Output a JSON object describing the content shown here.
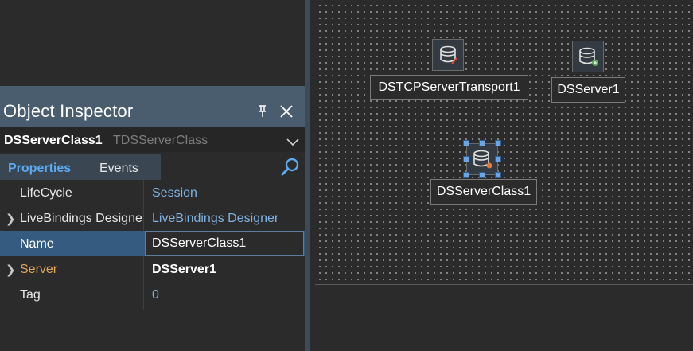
{
  "inspector": {
    "title": "Object Inspector",
    "selected_object": {
      "name": "DSServerClass1",
      "type": "TDSServerClass"
    },
    "tabs": [
      {
        "label": "Properties",
        "active": true
      },
      {
        "label": "Events",
        "active": false
      }
    ],
    "search": {
      "value": ""
    },
    "properties": [
      {
        "name": "LifeCycle",
        "value": "Session",
        "expandable": false
      },
      {
        "name": "LiveBindings Designer",
        "value": "LiveBindings Designer",
        "expandable": true
      },
      {
        "name": "Name",
        "value": "DSServerClass1",
        "expandable": false,
        "selected": true
      },
      {
        "name": "Server",
        "value": "DSServer1",
        "expandable": true
      },
      {
        "name": "Tag",
        "value": "0",
        "expandable": false
      }
    ]
  },
  "designer": {
    "components": [
      {
        "label": "DSTCPServerTransport1",
        "icon": "database-transport-icon"
      },
      {
        "label": "DSServer1",
        "icon": "database-server-icon"
      },
      {
        "label": "DSServerClass1",
        "icon": "database-class-icon",
        "selected": true
      }
    ]
  },
  "colors": {
    "accent": "#5da9f0",
    "title_bar": "#4a5d6e",
    "selected_row": "#365b80",
    "server_property": "#e0a45a"
  }
}
